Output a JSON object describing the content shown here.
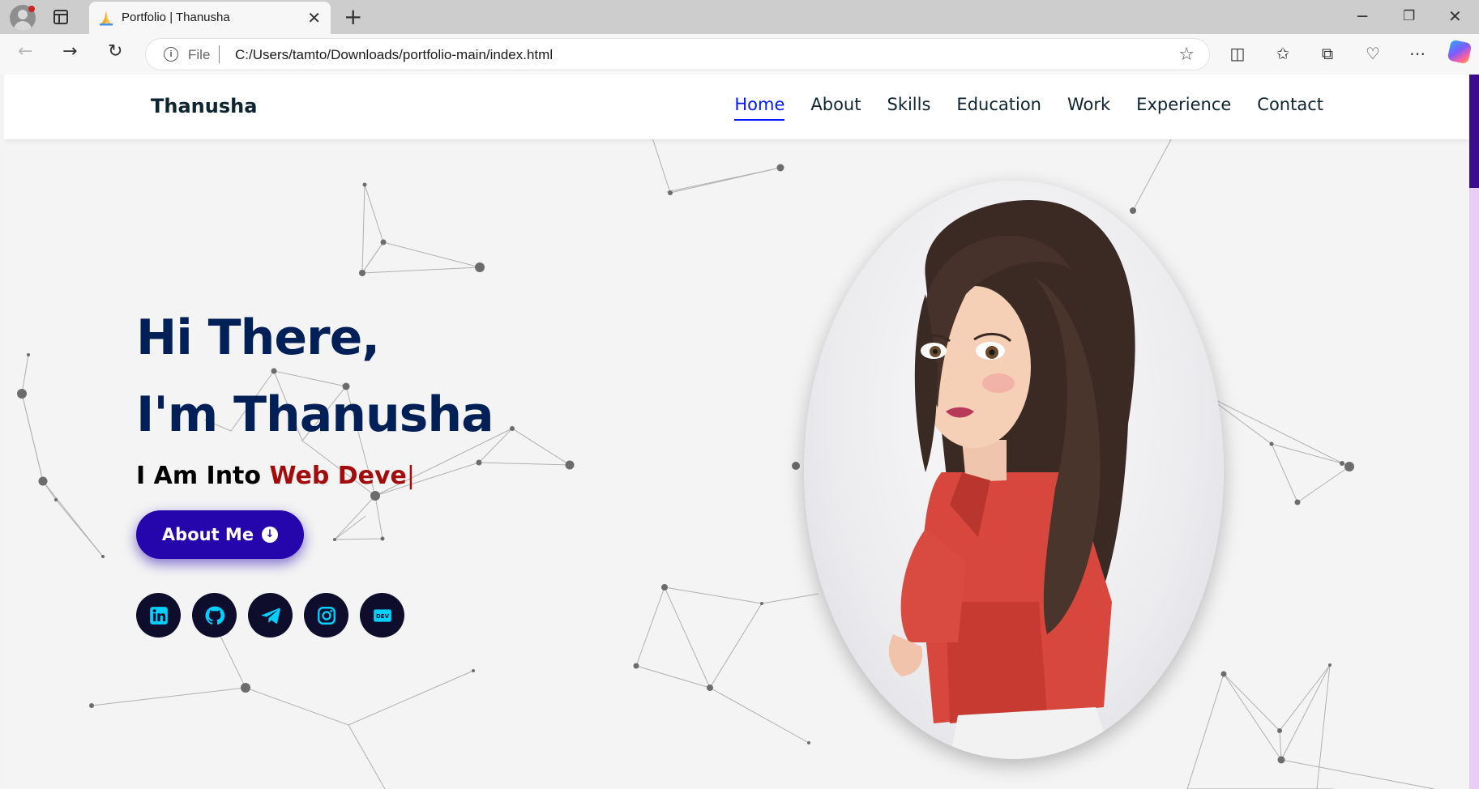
{
  "browser": {
    "tab_title": "Portfolio | Thanusha",
    "url_scheme": "File",
    "url": "C:/Users/tamto/Downloads/portfolio-main/index.html"
  },
  "header": {
    "brand": "Thanusha",
    "nav": [
      "Home",
      "About",
      "Skills",
      "Education",
      "Work",
      "Experience",
      "Contact"
    ],
    "active": "Home"
  },
  "hero": {
    "greeting_line1": "Hi There,",
    "greeting_line2": "I'm Thanusha",
    "typing_prefix": "I Am Into ",
    "typing_text": "Web Deve",
    "typing_caret": "|",
    "button_label": "About Me",
    "socials": [
      "linkedin-icon",
      "github-icon",
      "telegram-icon",
      "instagram-icon",
      "dev-icon"
    ],
    "dev_badge": "DEV"
  },
  "colors": {
    "accent": "#011aff",
    "heading": "#002057",
    "role_text": "#a30c0c",
    "button": "#2506ad",
    "social_bg": "#0e0e2c",
    "social_icon": "#00d0ff"
  }
}
